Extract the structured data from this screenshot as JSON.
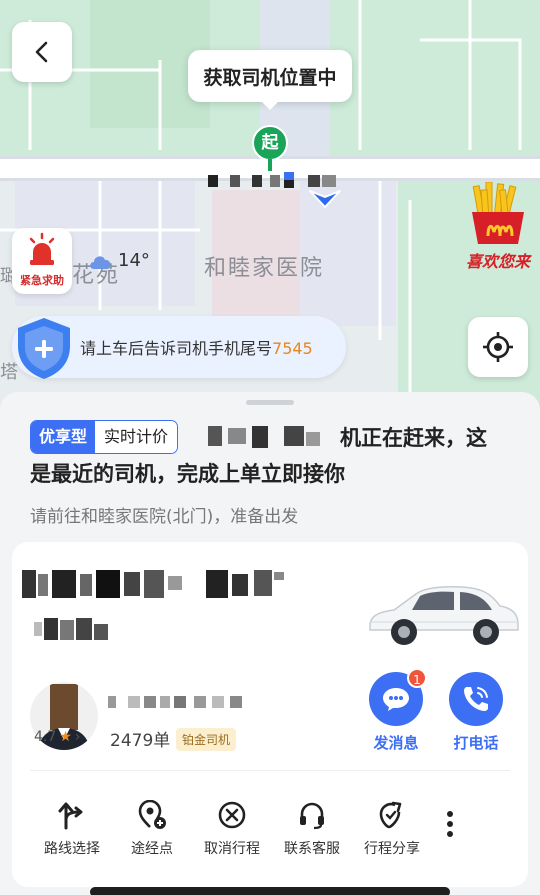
{
  "map": {
    "locating_tip": "获取司机位置中",
    "start_marker": "起",
    "sos_label": "紧急求助",
    "weather": {
      "temperature": "14°",
      "icon": "cloud-icon"
    },
    "poi_huayuan": "花苑",
    "poi_hospital": "和睦家医院",
    "poi_ta": "塔",
    "poi_ta2": "璐",
    "ad_text": "喜欢您来",
    "safety": {
      "text": "请上车后告诉司机手机尾号",
      "phone_tail": "7545"
    }
  },
  "sheet": {
    "tag_primary": "优享型",
    "tag_secondary": "实时计价",
    "status_line1": "机正在赶来，这",
    "status_line2": "是最近的司机，完成上单立即接你",
    "sub_hint": "请前往和睦家医院(北门)，准备出发"
  },
  "driver": {
    "rating": "4.7",
    "orders": "2479单",
    "grade": "铂金司机"
  },
  "actions": {
    "message_label": "发消息",
    "message_badge": "1",
    "call_label": "打电话"
  },
  "tools": [
    {
      "label": "路线选择",
      "icon": "route-icon"
    },
    {
      "label": "途经点",
      "icon": "waypoint-icon"
    },
    {
      "label": "取消行程",
      "icon": "cancel-icon"
    },
    {
      "label": "联系客服",
      "icon": "headset-icon"
    },
    {
      "label": "行程分享",
      "icon": "share-icon"
    }
  ],
  "colors": {
    "accent": "#3d6ff5",
    "start_green": "#1aa45a",
    "phone_orange": "#e5881e",
    "badge_red": "#f0553a"
  }
}
